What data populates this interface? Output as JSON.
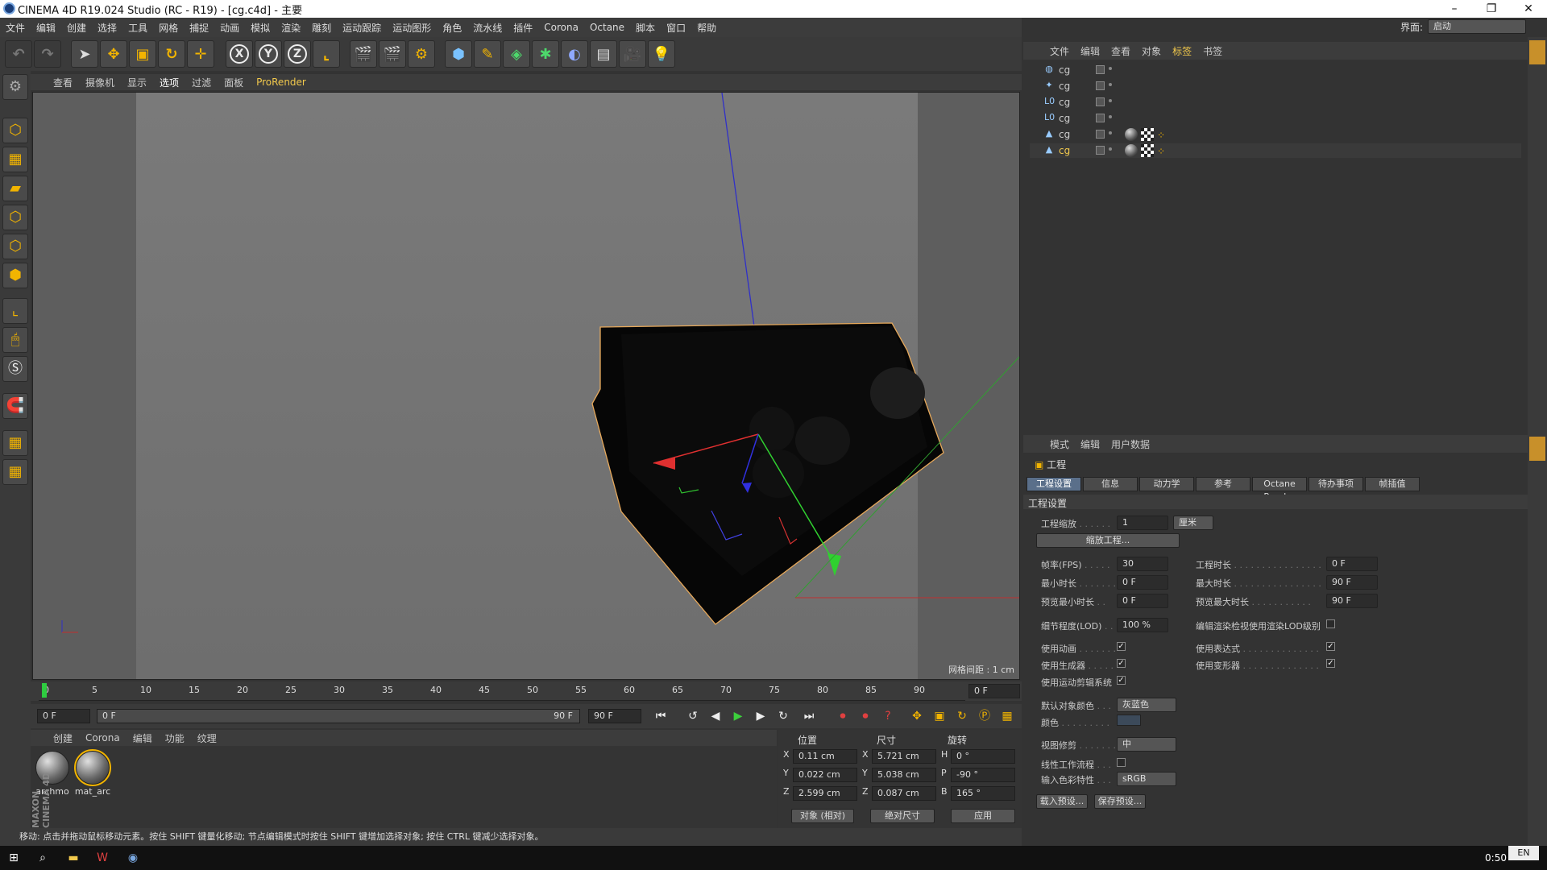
{
  "window": {
    "title": "CINEMA 4D R19.024 Studio (RC - R19) - [cg.c4d] - 主要"
  },
  "menubar": [
    "文件",
    "编辑",
    "创建",
    "选择",
    "工具",
    "网格",
    "捕捉",
    "动画",
    "模拟",
    "渲染",
    "雕刻",
    "运动跟踪",
    "运动图形",
    "角色",
    "流水线",
    "插件",
    "Corona",
    "Octane",
    "脚本",
    "窗口",
    "帮助"
  ],
  "layout": {
    "label": "界面:",
    "value": "启动"
  },
  "toolbar": {
    "axis_x": "X",
    "axis_y": "Y",
    "axis_z": "Z"
  },
  "viewport": {
    "menu": [
      "查看",
      "摄像机",
      "显示",
      "选项",
      "过滤",
      "面板",
      "ProRender"
    ],
    "selected_menu": "选项",
    "grid_spacing": "网格间距 : 1 cm"
  },
  "timeline": {
    "ticks": [
      "0",
      "5",
      "10",
      "15",
      "20",
      "25",
      "30",
      "35",
      "40",
      "45",
      "50",
      "55",
      "60",
      "65",
      "70",
      "75",
      "80",
      "85",
      "90"
    ],
    "current_frame": "0 F"
  },
  "transport": {
    "start": "0 F",
    "range_start": "0 F",
    "range_end": "90 F",
    "end": "90 F"
  },
  "material_manager": {
    "menu": [
      "创建",
      "Corona",
      "编辑",
      "功能",
      "纹理"
    ],
    "materials": [
      {
        "name": "archmo"
      },
      {
        "name": "mat_arc"
      }
    ]
  },
  "coordinates": {
    "headers": {
      "position": "位置",
      "size": "尺寸",
      "rotation": "旋转"
    },
    "rows": [
      {
        "axis": "X",
        "pos": "0.11 cm",
        "saxis": "X",
        "size": "5.721 cm",
        "raxis": "H",
        "rot": "0 °"
      },
      {
        "axis": "Y",
        "pos": "0.022 cm",
        "saxis": "Y",
        "size": "5.038 cm",
        "raxis": "P",
        "rot": "-90 °"
      },
      {
        "axis": "Z",
        "pos": "2.599 cm",
        "saxis": "Z",
        "size": "0.087 cm",
        "raxis": "B",
        "rot": "165 °"
      }
    ],
    "mode": "对象 (相对)",
    "size_mode": "绝对尺寸",
    "apply": "应用"
  },
  "statusbar": "移动: 点击并拖动鼠标移动元素。按住 SHIFT 键量化移动; 节点编辑模式时按住 SHIFT 键增加选择对象; 按住 CTRL 键减少选择对象。",
  "object_manager": {
    "menu": [
      "文件",
      "编辑",
      "查看",
      "对象",
      "标签",
      "书签"
    ],
    "active_menu": "标签",
    "objects": [
      {
        "name": "cg",
        "icon": "null-icon",
        "tags": []
      },
      {
        "name": "cg",
        "icon": "emitter-icon",
        "tags": []
      },
      {
        "name": "cg",
        "icon": "lo-icon",
        "tags": []
      },
      {
        "name": "cg",
        "icon": "lo-icon",
        "tags": []
      },
      {
        "name": "cg",
        "icon": "polygon-icon",
        "tags": [
          "material",
          "checker",
          "dots"
        ]
      },
      {
        "name": "cg",
        "icon": "polygon-icon",
        "tags": [
          "material",
          "checker",
          "dots"
        ],
        "selected": true
      }
    ]
  },
  "attribute_manager": {
    "menu": [
      "模式",
      "编辑",
      "用户数据"
    ],
    "section": "工程",
    "tabs": [
      "工程设置",
      "信息",
      "动力学",
      "参考",
      "Octane Render",
      "待办事项",
      "帧插值"
    ],
    "active_tab": "工程设置",
    "group_title": "工程设置",
    "scale": {
      "label": "工程缩放",
      "value": "1",
      "unit": "厘米"
    },
    "scale_button": "缩放工程...",
    "fps": {
      "label": "帧率(FPS)",
      "value": "30"
    },
    "project_time": {
      "label": "工程时长",
      "value": "0 F"
    },
    "min_time": {
      "label": "最小时长",
      "value": "0 F"
    },
    "max_time": {
      "label": "最大时长",
      "value": "90 F"
    },
    "preview_min": {
      "label": "预览最小时长",
      "value": "0 F"
    },
    "preview_max": {
      "label": "预览最大时长",
      "value": "90 F"
    },
    "lod": {
      "label": "细节程度(LOD)",
      "value": "100 %"
    },
    "lod_render": "编辑渲染检视使用渲染LOD级别",
    "use_animation": "使用动画",
    "use_expressions": "使用表达式",
    "use_generators": "使用生成器",
    "use_deformers": "使用变形器",
    "use_motion": "使用运动剪辑系统",
    "default_color": {
      "label": "默认对象颜色",
      "value": "灰蓝色"
    },
    "color": {
      "label": "颜色"
    },
    "view_clip": {
      "label": "视图修剪",
      "value": "中"
    },
    "linear": {
      "label": "线性工作流程"
    },
    "color_profile": {
      "label": "输入色彩特性",
      "value": "sRGB"
    },
    "load_preset": "载入预设...",
    "save_preset": "保存预设..."
  },
  "taskbar": {
    "time": "0:50",
    "lang": "EN"
  }
}
